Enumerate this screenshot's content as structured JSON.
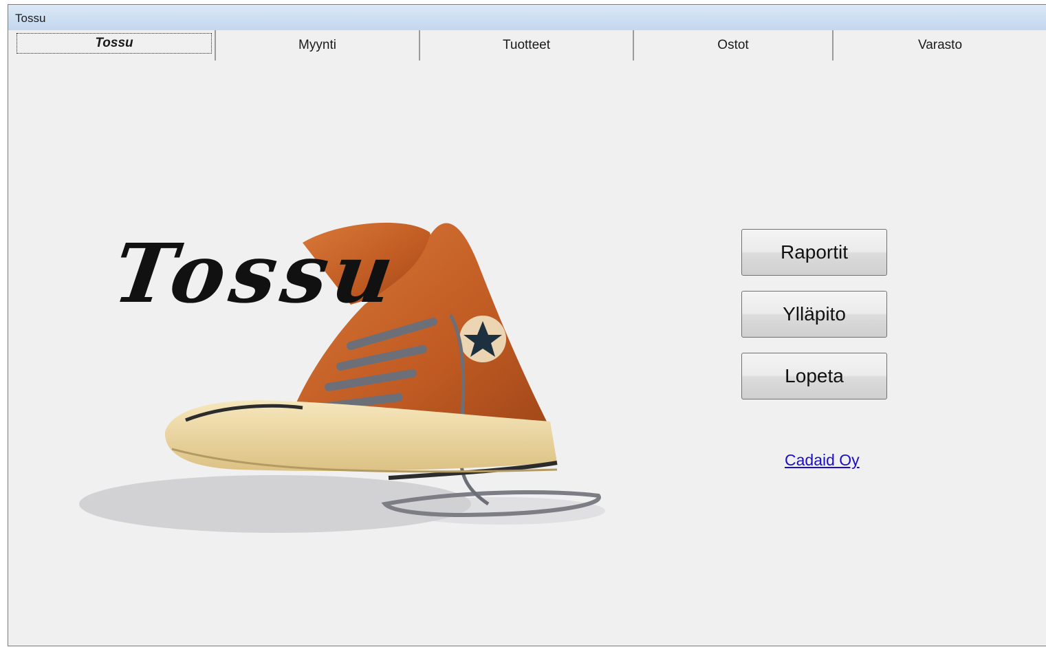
{
  "window": {
    "title": "Tossu"
  },
  "tabs": [
    {
      "label": "Tossu",
      "active": true
    },
    {
      "label": "Myynti"
    },
    {
      "label": "Tuotteet"
    },
    {
      "label": "Ostot"
    },
    {
      "label": "Varasto"
    }
  ],
  "logo": {
    "text": "Tossu"
  },
  "buttons": {
    "reports": "Raportit",
    "maintenance": "Ylläpito",
    "quit": "Lopeta"
  },
  "link": {
    "text": "Cadaid Oy"
  },
  "colors": {
    "shoe": "#c8642a",
    "sole": "#ecd8a4",
    "link": "#1a0dcc",
    "background": "#f0f0f0"
  }
}
